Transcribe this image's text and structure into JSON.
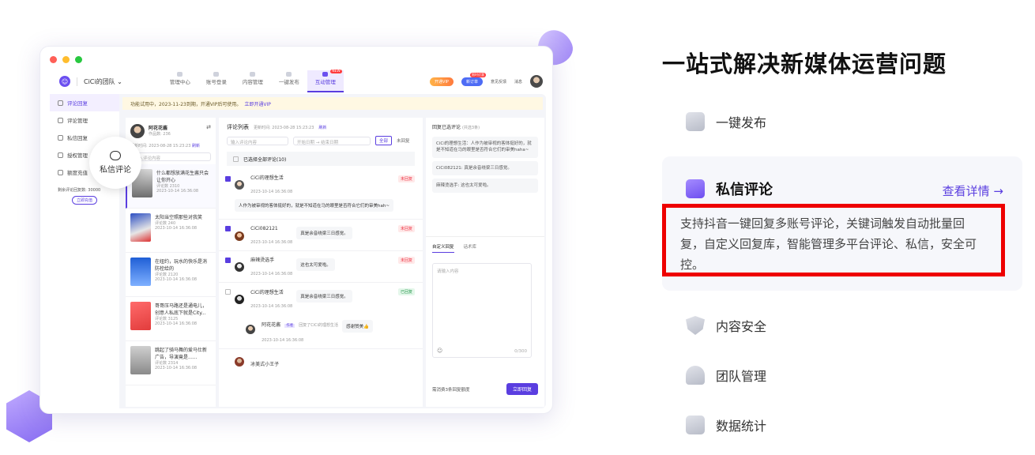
{
  "window": {
    "team_name": "CiCi的团队 ⌄",
    "nav": [
      {
        "label": "管理中心"
      },
      {
        "label": "账号登录"
      },
      {
        "label": "内容管理"
      },
      {
        "label": "一键发布"
      },
      {
        "label": "互动管理",
        "new": "NEW"
      }
    ],
    "topright": {
      "vip": "开通VIP",
      "new_badge": "新订单",
      "new_label": "新订单",
      "badge_tip": "限时优惠",
      "feedback": "意见反馈",
      "messages": "消息"
    },
    "sidebar": [
      {
        "label": "评论回复"
      },
      {
        "label": "评论管理"
      },
      {
        "label": "私信回复"
      },
      {
        "label": "授权管理"
      },
      {
        "label": "额度充值"
      }
    ],
    "quota_text": "剩余评论回复数: 30000",
    "quota_button": "立即充值",
    "bubble_label": "私信评论",
    "notice": "功能试用中，2023-11-23到期，开通VIP后可使用。",
    "notice_link": "立即开通VIP",
    "account": {
      "name": "阿花花酱",
      "works": "作品数: 236",
      "updated": "更新时间: 2023-08-28 15:23:23",
      "refresh": "刷新",
      "search_placeholder": "输入评论内容"
    },
    "videos": [
      {
        "title": "什么都想放满花生酱只会让你开心",
        "count": "评论数 2310",
        "date": "2023-10-14 16:36:08"
      },
      {
        "title": "太阳当空照那些对我笑",
        "count": "评论数 240",
        "date": "2023-10-14 16:36:08"
      },
      {
        "title": "在纽约，玩水的快乐是消防栓给的",
        "count": "评论数 2120",
        "date": "2023-10-14 16:36:08"
      },
      {
        "title": "哥哥压马路还是通电儿，创意人私底下就是City...",
        "count": "评论数 3125",
        "date": "2023-10-14 16:36:08"
      },
      {
        "title": "跳起了骑马舞的爱马仕新广告，导演竟是......",
        "count": "评论数 2314",
        "date": "2023-10-14 16:36:08"
      }
    ],
    "comments_panel": {
      "title": "评论列表",
      "updated": "更新时间: 2023-08-28 15:23:23",
      "refresh": "刷新",
      "search_placeholder": "输入评论内容",
      "start_placeholder": "开始日期",
      "end_placeholder": "结束日期",
      "filter_all": "全部",
      "filter_unreplied": "未回复",
      "select_all": "已选择全部评论(10)"
    },
    "comments": [
      {
        "name": "CiCi的理想生活",
        "date": "2023-10-14 16:36:08",
        "text": "人作为被审视的客体挺好的，就是不知道在马的眼里是否符合它们的审美hah~",
        "tag": "未回复",
        "checked": true
      },
      {
        "name": "CiCi082121",
        "date": "2023-10-14 16:36:08",
        "text": "真是余音绕梁三日感觉。",
        "tag": "未回复",
        "checked": true
      },
      {
        "name": "麻辣烫选手",
        "date": "2023-10-14 16:36:08",
        "text": "这也太可爱啦。",
        "tag": "未回复",
        "checked": true
      },
      {
        "name": "CiCi的理想生活",
        "date": "2023-10-14 16:36:08",
        "text": "真是余音绕梁三日感觉。",
        "tag": "已回复",
        "checked": false,
        "reply": {
          "name": "阿花花酱",
          "role": "作者",
          "to": "回复了CiCi的理想生活",
          "date": "2023-10-14 16:36:08",
          "text": "感谢赞美👍"
        }
      },
      {
        "name": "冰美式小王子",
        "date": "",
        "text": "",
        "tag": "",
        "checked": false
      }
    ],
    "reply_panel": {
      "title": "回复已选评论",
      "count": "(共选3条)",
      "items": [
        "CiCi的理想生活：人作为被审视的客体挺好的，就是不知道在马的眼里是否符合它们的审美haha~",
        "CiCi082121: 真是余音绕梁三日感觉。",
        "麻辣烫选手: 这也太可爱啦。"
      ],
      "tab_custom": "自定义回复",
      "tab_lib": "话术库",
      "input_placeholder": "请输入内容",
      "counter": "0/300",
      "cost": "需消费3条回复额度",
      "submit": "立即回复"
    }
  },
  "headline": "一站式解决新媒体运营问题",
  "features_top": [
    {
      "label": "一键发布",
      "icon": "publish-icon"
    }
  ],
  "active_feature": {
    "label": "私信评论",
    "more": "查看详情 →",
    "desc": "支持抖音一键回复多账号评论，关键词触发自动批量回复，自定义回复库，智能管理多平台评论、私信，安全可控。"
  },
  "features_bottom": [
    {
      "label": "内容安全",
      "icon": "shield-icon"
    },
    {
      "label": "团队管理",
      "icon": "team-icon"
    },
    {
      "label": "数据统计",
      "icon": "chart-icon"
    }
  ],
  "colors": {
    "accent": "#5a3ee0",
    "highlight_border": "#e00000"
  }
}
